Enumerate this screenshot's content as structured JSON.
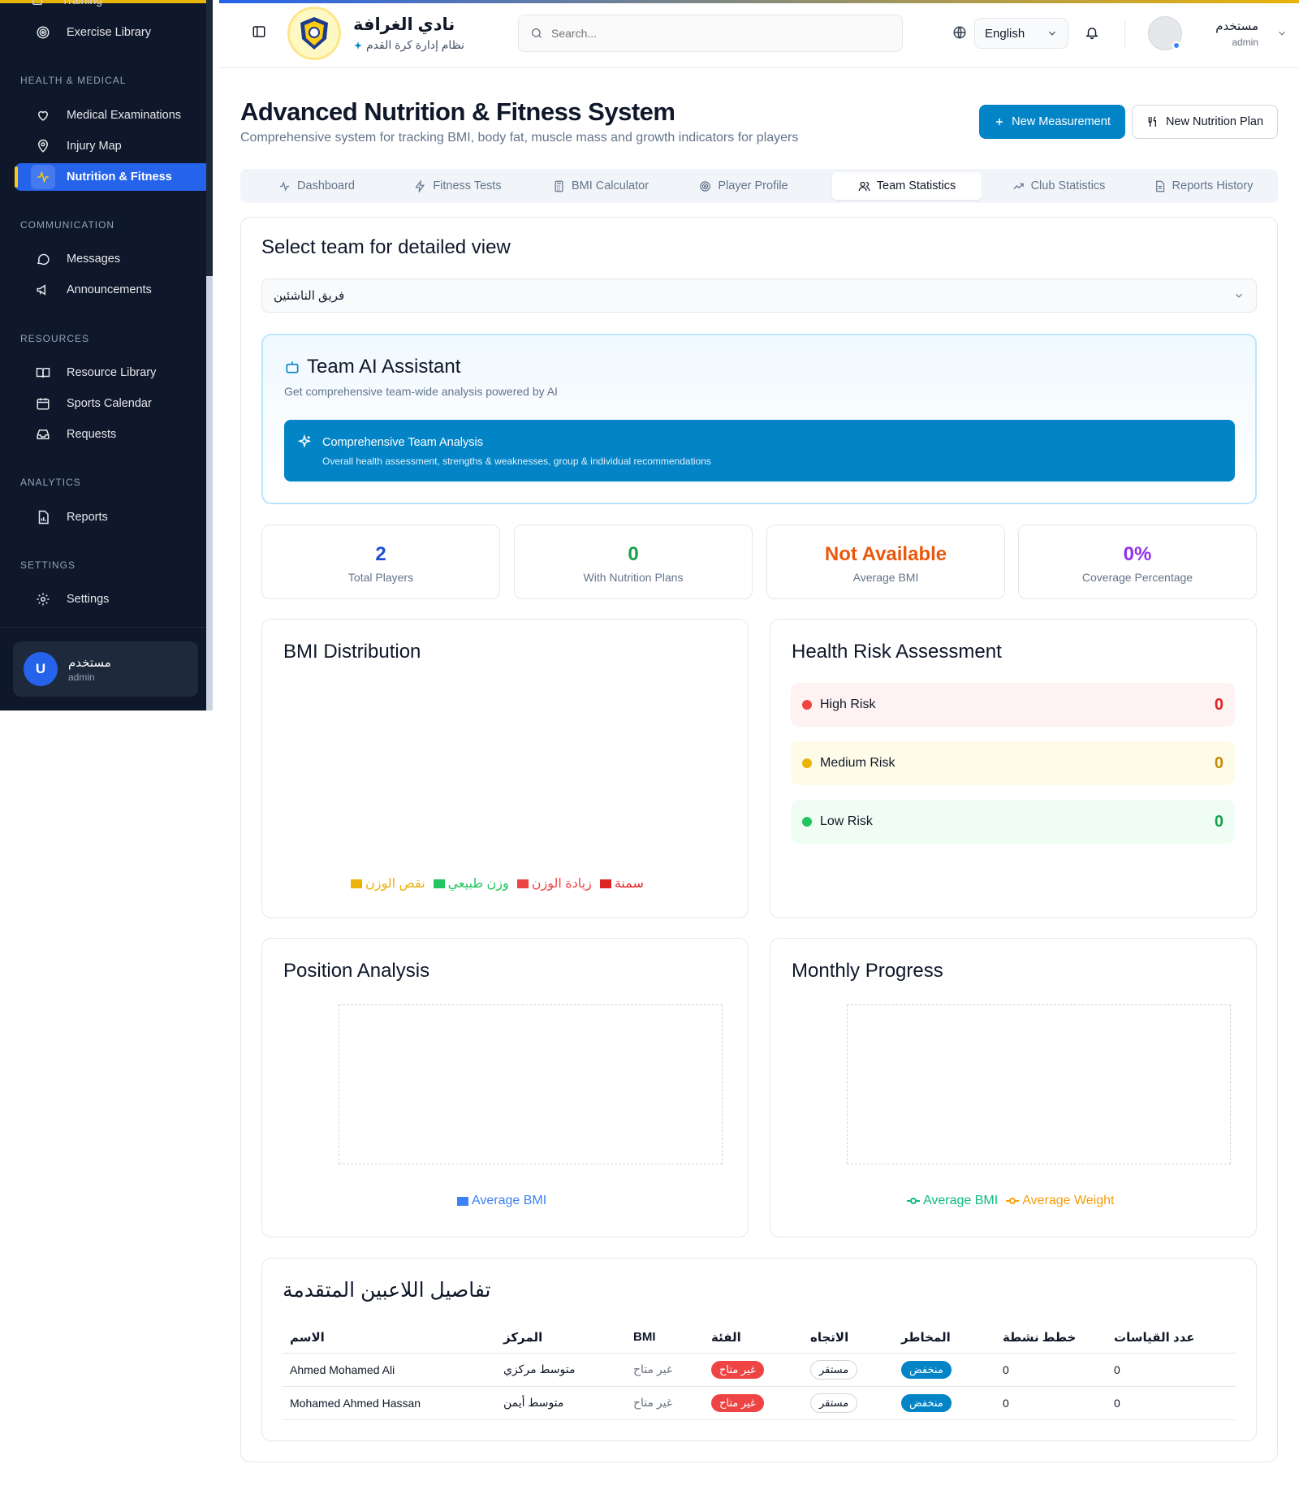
{
  "sidebar": {
    "cut_item": "Training",
    "exercise_library": "Exercise Library",
    "section_health": "HEALTH & MEDICAL",
    "medical_examinations": "Medical Examinations",
    "injury_map": "Injury Map",
    "nutrition_fitness": "Nutrition & Fitness",
    "section_communication": "COMMUNICATION",
    "messages": "Messages",
    "announcements": "Announcements",
    "section_resources": "RESOURCES",
    "resource_library": "Resource Library",
    "sports_calendar": "Sports Calendar",
    "requests": "Requests",
    "section_analytics": "ANALYTICS",
    "reports": "Reports",
    "section_settings": "SETTINGS",
    "settings": "Settings",
    "user": {
      "initial": "U",
      "name": "مستخدم",
      "role": "admin"
    }
  },
  "header": {
    "club_name": "نادي الغرافة",
    "club_subtitle": "نظام إدارة كرة القدم",
    "search_placeholder": "Search...",
    "language": "English",
    "user_name": "مستخدم",
    "user_role": "admin"
  },
  "page": {
    "title": "Advanced Nutrition & Fitness System",
    "subtitle": "Comprehensive system for tracking BMI, body fat, muscle mass and growth indicators for players",
    "new_measurement": "New Measurement",
    "new_nutrition_plan": "New Nutrition Plan"
  },
  "tabs": [
    "Dashboard",
    "Fitness Tests",
    "BMI Calculator",
    "Player Profile",
    "Team Statistics",
    "Club Statistics",
    "Reports History"
  ],
  "active_tab": "Team Statistics",
  "team_select": {
    "title": "Select team for detailed view",
    "value": "فريق الناشئين"
  },
  "ai": {
    "title": "Team AI Assistant",
    "subtitle": "Get comprehensive team-wide analysis powered by AI",
    "cta_title": "Comprehensive Team Analysis",
    "cta_sub": "Overall health assessment, strengths & weaknesses, group & individual recommendations"
  },
  "stats": [
    {
      "value": "2",
      "label": "Total Players",
      "color": "#1d4ed8"
    },
    {
      "value": "0",
      "label": "With Nutrition Plans",
      "color": "#16a34a"
    },
    {
      "value": "Not Available",
      "label": "Average BMI",
      "color": "#ea580c"
    },
    {
      "value": "0%",
      "label": "Coverage Percentage",
      "color": "#9333ea"
    }
  ],
  "bmi_distribution": {
    "title": "BMI Distribution",
    "legend": [
      {
        "label": "نقص الوزن",
        "color": "#eab308"
      },
      {
        "label": "وزن طبيعي",
        "color": "#22c55e"
      },
      {
        "label": "زيادة الوزن",
        "color": "#ef4444"
      },
      {
        "label": "سمنة",
        "color": "#dc2626"
      }
    ]
  },
  "health_risk": {
    "title": "Health Risk Assessment",
    "items": [
      {
        "label": "High Risk",
        "value": "0",
        "dot": "#ef4444",
        "bg": "#fef2f2",
        "color": "#dc2626"
      },
      {
        "label": "Medium Risk",
        "value": "0",
        "dot": "#eab308",
        "bg": "#fefce8",
        "color": "#ca8a04"
      },
      {
        "label": "Low Risk",
        "value": "0",
        "dot": "#22c55e",
        "bg": "#f0fdf4",
        "color": "#16a34a"
      }
    ]
  },
  "position_analysis": {
    "title": "Position Analysis",
    "legend": [
      {
        "label": "Average BMI",
        "color": "#3b82f6"
      }
    ]
  },
  "monthly_progress": {
    "title": "Monthly Progress",
    "legend": [
      {
        "label": "Average BMI",
        "color": "#10b981"
      },
      {
        "label": "Average Weight",
        "color": "#f59e0b"
      }
    ]
  },
  "players_table": {
    "title": "تفاصيل اللاعبين المتقدمة",
    "columns": [
      "الاسم",
      "المركز",
      "BMI",
      "الفئة",
      "الاتجاه",
      "المخاطر",
      "خطط نشطة",
      "عدد القياسات"
    ],
    "rows": [
      [
        "Ahmed Mohamed Ali",
        "متوسط مركزي",
        "غير متاح",
        "غير متاح",
        "مستقر",
        "منخفض",
        "0",
        "0"
      ],
      [
        "Mohamed Ahmed Hassan",
        "متوسط أيمن",
        "غير متاح",
        "غير متاح",
        "مستقر",
        "منخفض",
        "0",
        "0"
      ]
    ]
  }
}
